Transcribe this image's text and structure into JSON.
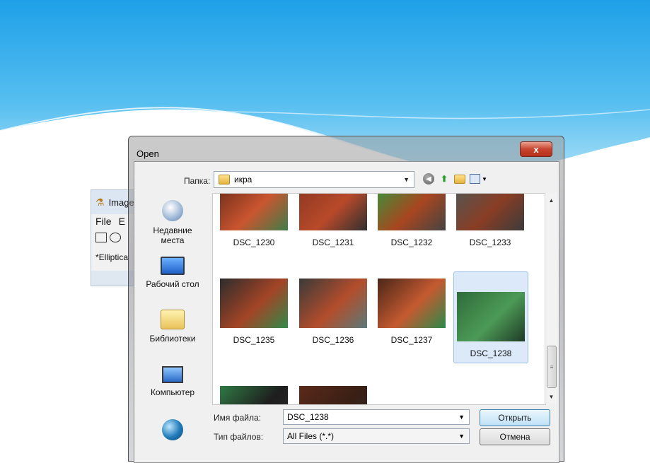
{
  "imagej": {
    "title": "Image",
    "menu": [
      "File",
      "E"
    ],
    "status": "*Elliptica"
  },
  "dialog": {
    "title": "Open",
    "close_label": "x",
    "lookin_label": "Папка:",
    "lookin_value": "икра",
    "toolbar_icons": [
      "back-icon",
      "up-folder-icon",
      "new-folder-icon",
      "view-menu-icon"
    ]
  },
  "places": [
    {
      "label_line1": "Недавние",
      "label_line2": "места",
      "icon": "recent-places-icon"
    },
    {
      "label_line1": "Рабочий стол",
      "label_line2": "",
      "icon": "desktop-icon"
    },
    {
      "label_line1": "Библиотеки",
      "label_line2": "",
      "icon": "libraries-icon"
    },
    {
      "label_line1": "Компьютер",
      "label_line2": "",
      "icon": "computer-icon"
    },
    {
      "label_line1": "",
      "label_line2": "",
      "icon": "network-icon"
    }
  ],
  "files": [
    {
      "name": "DSC_1230",
      "colors": [
        "#6a2a1a",
        "#c9552f",
        "#3f7d4a"
      ],
      "selected": false
    },
    {
      "name": "DSC_1231",
      "colors": [
        "#8a3520",
        "#b84a2a",
        "#2f2f2f"
      ],
      "selected": false
    },
    {
      "name": "DSC_1232",
      "colors": [
        "#2f9a3c",
        "#a8461f",
        "#444444"
      ],
      "selected": false
    },
    {
      "name": "DSC_1233",
      "colors": [
        "#4a5a5a",
        "#8a3d24",
        "#3b3b3b"
      ],
      "selected": false
    },
    {
      "name": "DSC_1235",
      "colors": [
        "#2c2c2c",
        "#a44426",
        "#2f8a4a"
      ],
      "selected": false
    },
    {
      "name": "DSC_1236",
      "colors": [
        "#3a3a3a",
        "#b34d2b",
        "#5a7a7a"
      ],
      "selected": false
    },
    {
      "name": "DSC_1237",
      "colors": [
        "#4a2618",
        "#c45a30",
        "#2a8a4a"
      ],
      "selected": false
    },
    {
      "name": "DSC_1238",
      "colors": [
        "#2f6b3a",
        "#4c9a56",
        "#1f3a26"
      ],
      "selected": true
    },
    {
      "name": "",
      "colors": [
        "#2f7a44",
        "#1e1e1e",
        "#2a2a2a"
      ],
      "selected": false
    },
    {
      "name": "",
      "colors": [
        "#5a2a1a",
        "#3a1f14",
        "#2a2a2a"
      ],
      "selected": false
    }
  ],
  "filename_label": "Имя файла:",
  "filename_value": "DSC_1238",
  "filetype_label": "Тип файлов:",
  "filetype_value": "All Files (*.*)",
  "open_button": "Открыть",
  "cancel_button": "Отмена",
  "colors": {
    "slide_top": "#2aa6e6",
    "slide_bottom": "#8fd3f5",
    "selection_fill": "#dbe9f9",
    "selection_border": "#9cc0e8"
  }
}
